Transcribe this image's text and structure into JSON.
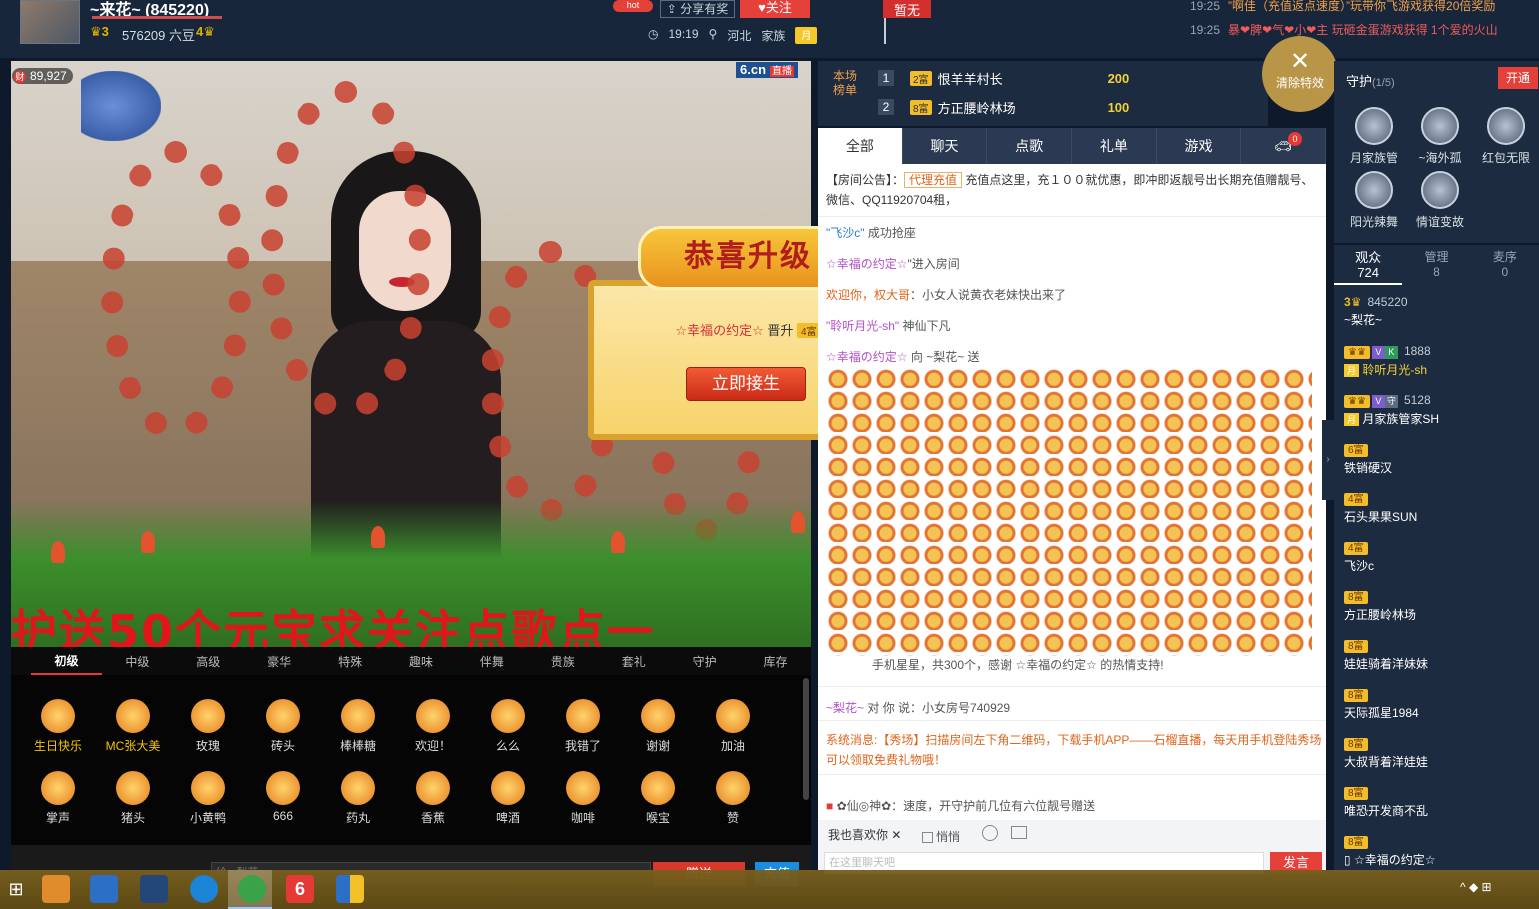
{
  "header": {
    "host_name": "~来花~ (845220)",
    "level_a": "3",
    "beans": "576209 六豆",
    "level_b": "4",
    "hot_label": "hot",
    "share_label": "分享有奖",
    "follow_label": "关注",
    "time": "19:19",
    "location": "河北",
    "family_label": "家族",
    "month_badge": "月",
    "flag_label": "暂无"
  },
  "ticker": [
    {
      "time": "19:25",
      "text": "”啊佳（充值返点速度）”玩带你飞游戏获得20倍奖励"
    },
    {
      "time": "19:25",
      "text": "暴❤脾❤气❤小❤主 玩砸金蛋游戏获得 1个爱的火山"
    }
  ],
  "video": {
    "wealth": "89,927",
    "wealth_icon": "财",
    "logo": "6.cn",
    "live_tag": "直播",
    "scroll_text": "护送50个元宝求关注点歌点一"
  },
  "popup": {
    "title": "恭喜升级",
    "user": "☆幸福の约定☆",
    "verb": "晋升",
    "new_level": "4富",
    "button": "立即接生"
  },
  "gift_tabs": [
    "初级",
    "中级",
    "高级",
    "豪华",
    "特殊",
    "趣味",
    "伴舞",
    "贵族",
    "套礼",
    "守护",
    "库存"
  ],
  "gifts_row1": [
    {
      "name": "生日快乐",
      "highlight": true
    },
    {
      "name": "MC张大美",
      "highlight": true
    },
    {
      "name": "玫瑰",
      "highlight": false
    },
    {
      "name": "砖头",
      "highlight": false
    },
    {
      "name": "棒棒糖",
      "highlight": false
    },
    {
      "name": "欢迎！",
      "highlight": false
    },
    {
      "name": "么么",
      "highlight": false
    },
    {
      "name": "我错了",
      "highlight": false
    },
    {
      "name": "谢谢",
      "highlight": false
    },
    {
      "name": "加油",
      "highlight": false
    }
  ],
  "gifts_row2": [
    {
      "name": "掌声"
    },
    {
      "name": "猪头"
    },
    {
      "name": "小黄鸭"
    },
    {
      "name": "666"
    },
    {
      "name": "药丸"
    },
    {
      "name": "香蕉"
    },
    {
      "name": "啤酒"
    },
    {
      "name": "咖啡"
    },
    {
      "name": "喉宝"
    },
    {
      "name": "赞"
    }
  ],
  "bottom": {
    "send_to_prefix": "给",
    "send_to": "~梨花~",
    "send_gift": "赠送",
    "recharge": "充值"
  },
  "rank": {
    "label": "本场榜单",
    "rows": [
      {
        "no": "1",
        "level": "2富",
        "name": "恨羊羊村长",
        "score": "200"
      },
      {
        "no": "2",
        "level": "8富",
        "name": "方正腰岭林场",
        "score": "100"
      }
    ]
  },
  "clear_fx": "清除特效",
  "chat": {
    "tabs": [
      "全部",
      "聊天",
      "点歌",
      "礼单",
      "游戏"
    ],
    "car_badge": "0",
    "notice_prefix": "【房间公告】：",
    "notice_tag": "代理充值",
    "notice_text": "充值点这里，充１００就优惠，即冲即返靓号出长期充值赠靓号、微信、QQ11920704租，",
    "messages": [
      {
        "a": "\"飞沙c\"",
        "b": "成功抢座"
      },
      {
        "a": "☆幸福の约定☆",
        "b": "\"进入房间"
      },
      {
        "a": "欢迎你，权大哥",
        "b": "：小女人说黄衣老妹快出来了"
      },
      {
        "a": "\"聆听月光-sh\"",
        "b": "神仙下凡"
      },
      {
        "a": "☆幸福の约定☆",
        "b": "向 ~梨花~ 送"
      }
    ],
    "thanks": "手机星星，共300个，感谢 ☆幸福の约定☆ 的热情支持!",
    "private_from": "~梨花~",
    "private_mid": "对 你 说：",
    "private_text": "小女房号740929",
    "sys_prefix": "系统消息:",
    "sys_text": "【秀场】扫描房间左下角二维码，下载手机APP——石榴直播，每天用手机登陆秀场可以领取免费礼物哦！",
    "guard_msg": "✿仙◎神✿：速度，开守护前几位有六位靓号赠送",
    "quick_reply": "我也喜欢你",
    "whisper": "悄悄",
    "input_placeholder": "在这里聊天吧",
    "send": "发言"
  },
  "guard": {
    "title": "守护",
    "count": "(1/5)",
    "open": "开通",
    "members": [
      "月家族管",
      "~海外孤",
      "红包无限",
      "阳光辣舞",
      "情谊变故"
    ]
  },
  "audience": {
    "tabs": [
      {
        "label": "观众",
        "count": "724"
      },
      {
        "label": "管理",
        "count": "8"
      },
      {
        "label": "麦序",
        "count": "0"
      }
    ],
    "items": [
      {
        "level": "3",
        "num": "845220",
        "name": "~梨花~",
        "gold": false
      },
      {
        "level": "",
        "num": "1888",
        "name": "聆听月光-sh",
        "gold": true
      },
      {
        "level": "",
        "num": "5128",
        "name": "月家族管家SH",
        "gold": false
      },
      {
        "level": "6富",
        "num": "",
        "name": "铁销硬汉",
        "gold": false
      },
      {
        "level": "4富",
        "num": "",
        "name": "石头果果SUN",
        "gold": false
      },
      {
        "level": "4富",
        "num": "",
        "name": "飞沙c",
        "gold": false
      },
      {
        "level": "8富",
        "num": "",
        "name": "方正腰岭林场",
        "gold": false
      },
      {
        "level": "8富",
        "num": "",
        "name": "娃娃骑着洋妹妹",
        "gold": false
      },
      {
        "level": "8富",
        "num": "",
        "name": "天际孤星1984",
        "gold": false
      },
      {
        "level": "8富",
        "num": "",
        "name": "大叔背着洋娃娃",
        "gold": false
      },
      {
        "level": "8富",
        "num": "",
        "name": "唯恐开发商不乱",
        "gold": false
      },
      {
        "level": "8富",
        "num": "",
        "name": "☆幸福の约定☆",
        "gold": false
      }
    ]
  },
  "taskbar": {
    "tray": "^ ◆ ⊞"
  },
  "colors": {
    "accent_red": "#e5413a",
    "panel": "#1c2b3f",
    "gold": "#f2bc2a"
  }
}
